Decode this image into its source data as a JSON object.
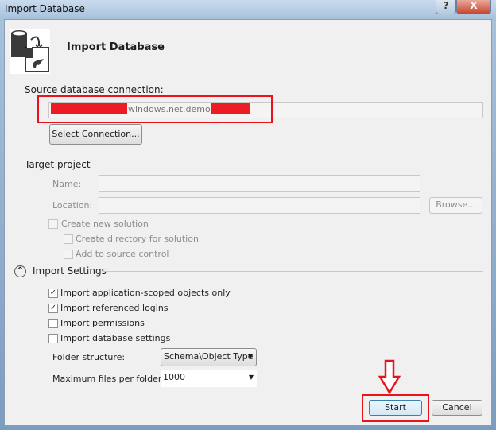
{
  "window": {
    "title": "Import Database",
    "help_label": "?",
    "close_label": "X"
  },
  "header": {
    "title": "Import Database",
    "icon": "import-database-icon"
  },
  "source": {
    "label": "Source database connection:",
    "value": "windows.net.demodb",
    "select_button": "Select Connection..."
  },
  "target": {
    "label": "Target project",
    "name_label": "Name:",
    "name_value": "",
    "location_label": "Location:",
    "location_value": "",
    "browse_button": "Browse...",
    "create_solution": "Create new solution",
    "create_directory": "Create directory for solution",
    "add_source_control": "Add to source control"
  },
  "settings": {
    "label": "Import Settings",
    "options": [
      {
        "label": "Import application-scoped objects only",
        "checked": true
      },
      {
        "label": "Import referenced logins",
        "checked": true
      },
      {
        "label": "Import permissions",
        "checked": false
      },
      {
        "label": "Import database settings",
        "checked": false
      }
    ],
    "folder_label": "Folder structure:",
    "folder_value": "Schema\\Object Type",
    "max_files_label": "Maximum files per folder:",
    "max_files_value": "1000"
  },
  "footer": {
    "start": "Start",
    "cancel": "Cancel"
  },
  "colors": {
    "highlight": "#e8141b"
  }
}
